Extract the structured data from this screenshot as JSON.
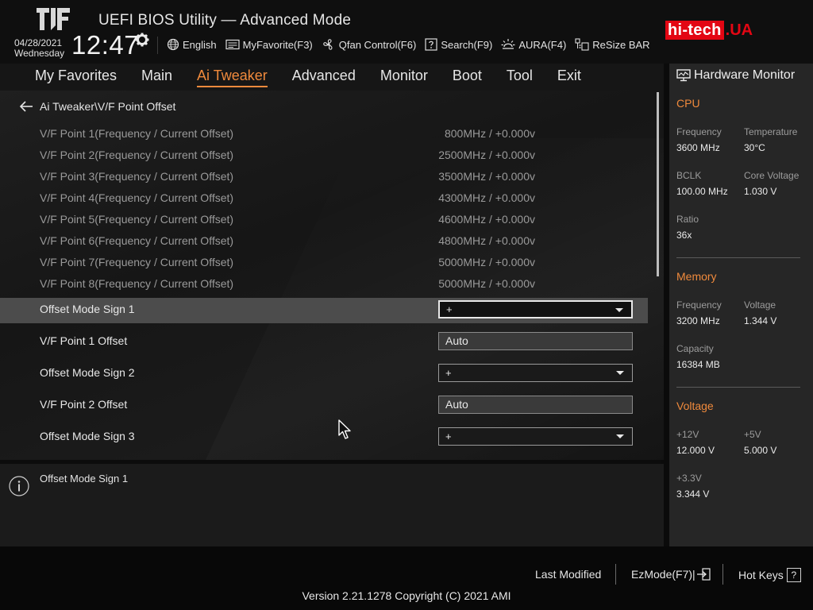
{
  "header": {
    "title": "UEFI BIOS Utility — Advanced Mode",
    "date": "04/28/2021",
    "weekday": "Wednesday",
    "time": "12:47",
    "tools": [
      {
        "label": "English",
        "icon": "globe-icon"
      },
      {
        "label": "MyFavorite(F3)",
        "icon": "favorite-icon"
      },
      {
        "label": "Qfan Control(F6)",
        "icon": "fan-icon"
      },
      {
        "label": "Search(F9)",
        "icon": "search-help-icon"
      },
      {
        "label": "AURA(F4)",
        "icon": "aura-light-icon"
      },
      {
        "label": "ReSize BAR",
        "icon": "resize-bar-icon"
      }
    ],
    "watermark_main": "hi-tech",
    "watermark_suffix": ".UA"
  },
  "menu": {
    "items": [
      "My Favorites",
      "Main",
      "Ai Tweaker",
      "Advanced",
      "Monitor",
      "Boot",
      "Tool",
      "Exit"
    ],
    "active": "Ai Tweaker"
  },
  "main": {
    "breadcrumb": "Ai Tweaker\\V/F Point Offset",
    "vf_points": [
      {
        "label": "V/F Point 1(Frequency / Current Offset)",
        "value": "800MHz / +0.000v"
      },
      {
        "label": "V/F Point 2(Frequency / Current Offset)",
        "value": "2500MHz / +0.000v"
      },
      {
        "label": "V/F Point 3(Frequency / Current Offset)",
        "value": "3500MHz / +0.000v"
      },
      {
        "label": "V/F Point 4(Frequency / Current Offset)",
        "value": "4300MHz / +0.000v"
      },
      {
        "label": "V/F Point 5(Frequency / Current Offset)",
        "value": "4600MHz / +0.000v"
      },
      {
        "label": "V/F Point 6(Frequency / Current Offset)",
        "value": "4800MHz / +0.000v"
      },
      {
        "label": "V/F Point 7(Frequency / Current Offset)",
        "value": "5000MHz / +0.000v"
      },
      {
        "label": "V/F Point 8(Frequency / Current Offset)",
        "value": "5000MHz / +0.000v"
      }
    ],
    "options": [
      {
        "label": "Offset Mode Sign 1",
        "value": "+",
        "type": "select",
        "selected": true
      },
      {
        "label": "V/F Point 1 Offset",
        "value": "Auto",
        "type": "text"
      },
      {
        "label": "Offset Mode Sign 2",
        "value": "+",
        "type": "select"
      },
      {
        "label": "V/F Point 2 Offset",
        "value": "Auto",
        "type": "text"
      },
      {
        "label": "Offset Mode Sign 3",
        "value": "+",
        "type": "select"
      }
    ]
  },
  "help": {
    "text": "Offset Mode Sign 1"
  },
  "hardware_monitor": {
    "title": "Hardware Monitor",
    "cpu": {
      "title": "CPU",
      "frequency_label": "Frequency",
      "frequency": "3600 MHz",
      "temperature_label": "Temperature",
      "temperature": "30°C",
      "bclk_label": "BCLK",
      "bclk": "100.00 MHz",
      "core_voltage_label": "Core Voltage",
      "core_voltage": "1.030 V",
      "ratio_label": "Ratio",
      "ratio": "36x"
    },
    "memory": {
      "title": "Memory",
      "frequency_label": "Frequency",
      "frequency": "3200 MHz",
      "voltage_label": "Voltage",
      "voltage": "1.344 V",
      "capacity_label": "Capacity",
      "capacity": "16384 MB"
    },
    "voltage": {
      "title": "Voltage",
      "v12_label": "+12V",
      "v12": "12.000 V",
      "v5_label": "+5V",
      "v5": "5.000 V",
      "v33_label": "+3.3V",
      "v33": "3.344 V"
    }
  },
  "footer": {
    "last_modified": "Last Modified",
    "ezmode": "EzMode(F7)|",
    "hotkeys": "Hot Keys",
    "hotkeys_key": "?",
    "version": "Version 2.21.1278 Copyright (C) 2021 AMI"
  },
  "colors": {
    "accent": "#f08a3c",
    "watermark_red": "#e30613"
  }
}
